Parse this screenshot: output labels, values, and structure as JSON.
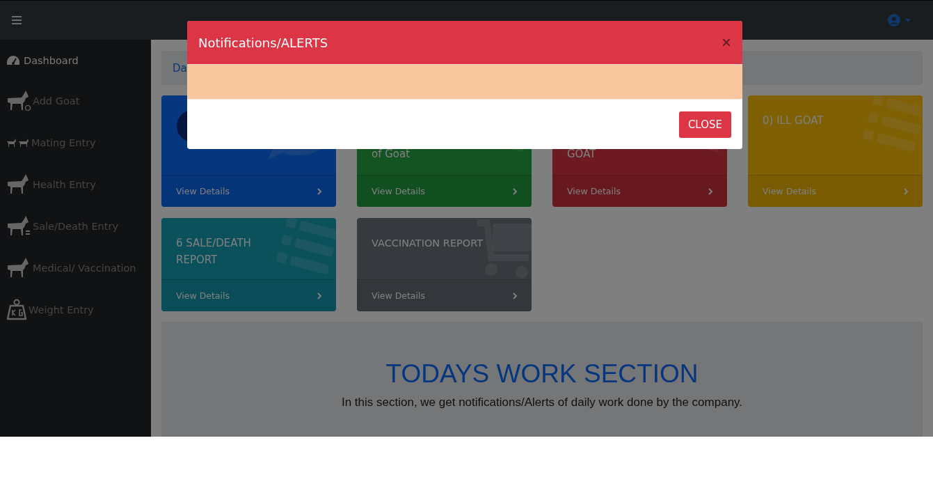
{
  "sidebar": {
    "items": [
      {
        "label": "Dashboard",
        "selected": true
      },
      {
        "label": "Add Goat",
        "selected": false
      },
      {
        "label": "Mating Entry",
        "selected": false
      },
      {
        "label": "Health Entry",
        "selected": false
      },
      {
        "label": "Sale/Death Entry",
        "selected": false
      },
      {
        "label": "Medical/ Vaccination",
        "selected": false
      },
      {
        "label": "Weight Entry",
        "selected": false
      }
    ]
  },
  "breadcrumb": {
    "text": "Da"
  },
  "cards": [
    {
      "link": "View Details"
    },
    {
      "title": "of Goat",
      "link": "View Details"
    },
    {
      "title": "GOAT",
      "link": "View Details"
    },
    {
      "title": "0) ILL GOAT",
      "link": "View Details"
    },
    {
      "title": "6 SALE/DEATH REPORT",
      "link": "View Details"
    },
    {
      "title": "VACCINATION REPORT",
      "link": "View Details"
    }
  ],
  "work_section": {
    "heading": "TODAYS WORK SECTION",
    "text": "In this section, we get notifications/Alerts of daily work done by the company."
  },
  "modal": {
    "title": "Notifications/ALERTS",
    "close_symbol": "×",
    "button": "CLOSE"
  }
}
